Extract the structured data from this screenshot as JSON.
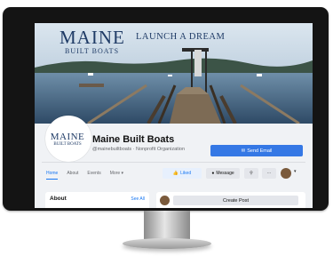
{
  "cover": {
    "brand_main": "MAINE",
    "brand_sub": "BUILT BOATS",
    "tagline": "LAUNCH A DREAM"
  },
  "profile": {
    "logo_main": "MAINE",
    "logo_sub": "BUILT BOATS",
    "page_name": "Maine Built Boats",
    "handle_line": "@mainebuiltboats · Nonprofit Organization"
  },
  "actions": {
    "send_email_label": "Send Email",
    "liked_label": "Liked",
    "message_label": "Message",
    "search_glyph": "⚲",
    "more_glyph": "···",
    "caret_glyph": "▾"
  },
  "tabs": [
    {
      "label": "Home",
      "active": true
    },
    {
      "label": "About",
      "active": false
    },
    {
      "label": "Events",
      "active": false
    },
    {
      "label": "More ▾",
      "active": false
    }
  ],
  "about_panel": {
    "title": "About",
    "see_all_label": "See All"
  },
  "post_panel": {
    "create_post_label": "Create Post"
  },
  "colors": {
    "accent": "#3578e5",
    "brand_navy": "#1f3b66",
    "page_bg": "#f0f2f5"
  }
}
